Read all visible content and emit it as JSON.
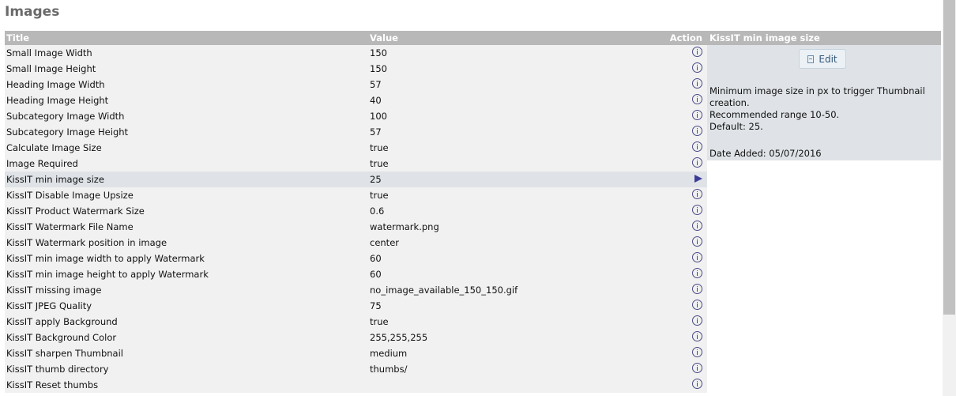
{
  "page": {
    "title": "Images"
  },
  "table": {
    "headers": {
      "title": "Title",
      "value": "Value",
      "action": "Action"
    },
    "selected_index": 8,
    "rows": [
      {
        "title": "Small Image Width",
        "value": "150"
      },
      {
        "title": "Small Image Height",
        "value": "150"
      },
      {
        "title": "Heading Image Width",
        "value": "57"
      },
      {
        "title": "Heading Image Height",
        "value": "40"
      },
      {
        "title": "Subcategory Image Width",
        "value": "100"
      },
      {
        "title": "Subcategory Image Height",
        "value": "57"
      },
      {
        "title": "Calculate Image Size",
        "value": "true"
      },
      {
        "title": "Image Required",
        "value": "true"
      },
      {
        "title": "KissIT min image size",
        "value": "25"
      },
      {
        "title": "KissIT Disable Image Upsize",
        "value": "true"
      },
      {
        "title": "KissIT Product Watermark Size",
        "value": "0.6"
      },
      {
        "title": "KissIT Watermark File Name",
        "value": "watermark.png"
      },
      {
        "title": "KissIT Watermark position in image",
        "value": "center"
      },
      {
        "title": "KissIT min image width to apply Watermark",
        "value": "60"
      },
      {
        "title": "KissIT min image height to apply Watermark",
        "value": "60"
      },
      {
        "title": "KissIT missing image",
        "value": "no_image_available_150_150.gif"
      },
      {
        "title": "KissIT JPEG Quality",
        "value": "75"
      },
      {
        "title": "KissIT apply Background",
        "value": "true"
      },
      {
        "title": "KissIT Background Color",
        "value": "255,255,255"
      },
      {
        "title": "KissIT sharpen Thumbnail",
        "value": "medium"
      },
      {
        "title": "KissIT thumb directory",
        "value": "thumbs/"
      },
      {
        "title": "KissIT Reset thumbs",
        "value": ""
      }
    ]
  },
  "infobox": {
    "heading": "KissIT min image size",
    "edit_label": "Edit",
    "description_lines": [
      "Minimum image size in px to trigger Thumbnail creation.",
      "Recommended range 10-50.",
      "Default: 25."
    ],
    "date_added": "Date Added: 05/07/2016"
  },
  "icons": {
    "row_action": "info-icon",
    "selected_row_action": "arrow-right-icon",
    "edit_button_icon": "document-icon"
  },
  "colors": {
    "header_bg": "#b8b8b8",
    "row_bg": "#f0f1f0",
    "selected_row_bg": "#dfe3e7",
    "title_color": "#6a6a6a",
    "icon_color": "#3c3c98"
  }
}
